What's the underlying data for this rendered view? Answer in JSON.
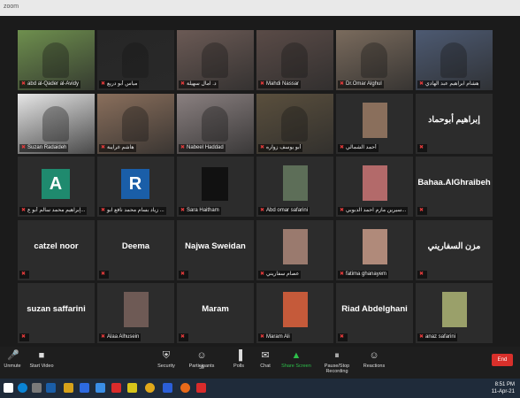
{
  "window": {
    "title": "zoom"
  },
  "tiles": [
    {
      "label": "abd al-Qader al-Avidy",
      "kind": "photo",
      "bg": "#6e8f4e"
    },
    {
      "label": "مياس أبو دريع",
      "kind": "photo",
      "bg": "#262626"
    },
    {
      "label": "د. آمال سهيلة",
      "kind": "photo",
      "bg": "#6b5a55"
    },
    {
      "label": "Mahdi Nassar",
      "kind": "photo",
      "bg": "#5a4b47"
    },
    {
      "label": "Dr.Omar Alghul",
      "kind": "photo",
      "bg": "#7a6b5d"
    },
    {
      "label": "هشام ابراهيم عبد الهادي",
      "kind": "photo",
      "bg": "#4d5a72"
    },
    {
      "label": "Suzan Radaideh",
      "kind": "photo",
      "bg": "#e6e6e6",
      "active": true
    },
    {
      "label": "هاشم غرايبة",
      "kind": "photo",
      "bg": "#8a6f5c"
    },
    {
      "label": "Nabeel Haddad",
      "kind": "photo",
      "bg": "#8a8080"
    },
    {
      "label": "أبو يوسف زواره",
      "kind": "photo",
      "bg": "#5a4f3d"
    },
    {
      "label": "أحمد الشمالي",
      "kind": "thumb",
      "bg": "#2c2c2c",
      "thumb": "#8a6f5c"
    },
    {
      "label": "",
      "name": "إبراهيم أبوحماد",
      "kind": "name"
    },
    {
      "label": "إبراهيم محمد سالم أبو ع...",
      "kind": "initial",
      "initial": "A",
      "color": "#1f8a6e"
    },
    {
      "label": "زياد بسام محمد نافع ابو ...",
      "kind": "initial",
      "initial": "R",
      "color": "#1a5ea8"
    },
    {
      "label": "Sara Haitham",
      "kind": "logo",
      "bg": "#111111"
    },
    {
      "label": "Abd omar safarini",
      "kind": "thumb",
      "bg": "#2c2c2c",
      "thumb": "#5d6e58"
    },
    {
      "label": "سيرين مازم احمد الدبوبي...",
      "kind": "thumb",
      "bg": "#2c2c2c",
      "thumb": "#b36a6a"
    },
    {
      "label": "",
      "name": "Bahaa.AlGhraibeh",
      "kind": "name"
    },
    {
      "label": "",
      "name": "catzel noor",
      "kind": "name"
    },
    {
      "label": "",
      "name": "Deema",
      "kind": "name"
    },
    {
      "label": "",
      "name": "Najwa Sweidan",
      "kind": "name"
    },
    {
      "label": "عصام سفاريني",
      "kind": "thumb",
      "bg": "#2c2c2c",
      "thumb": "#9a7a6e"
    },
    {
      "label": "fatima ghanayem",
      "kind": "thumb",
      "bg": "#2c2c2c",
      "thumb": "#b08a7a"
    },
    {
      "label": "",
      "name": "مزن السفاريني",
      "kind": "name"
    },
    {
      "label": "",
      "name": "suzan saffarini",
      "kind": "name"
    },
    {
      "label": "Alaa Alhusein",
      "kind": "thumb",
      "bg": "#2c2c2c",
      "thumb": "#6e5a55"
    },
    {
      "label": "",
      "name": "Maram",
      "kind": "name"
    },
    {
      "label": "Maram Ali",
      "kind": "thumb",
      "bg": "#2c2c2c",
      "thumb": "#c55a3a"
    },
    {
      "label": "",
      "name": "Riad Abdelghani",
      "kind": "name"
    },
    {
      "label": "anaz safarini",
      "kind": "thumb",
      "bg": "#2c2c2c",
      "thumb": "#9aa06a"
    }
  ],
  "toolbar": {
    "unmute": "Unmute",
    "start_video": "Start Video",
    "security": "Security",
    "participants": "Participants",
    "participants_count": "30",
    "polls": "Polls",
    "chat": "Chat",
    "share_screen": "Share Screen",
    "recording": "Pause/Stop Recording",
    "reactions": "Reactions",
    "end": "End"
  },
  "clock": {
    "time": "8:51 PM",
    "date": "11-Apr-21"
  },
  "colors": {
    "accent": "#9acd32",
    "end": "#d9302b",
    "share": "#2dbf4a"
  }
}
